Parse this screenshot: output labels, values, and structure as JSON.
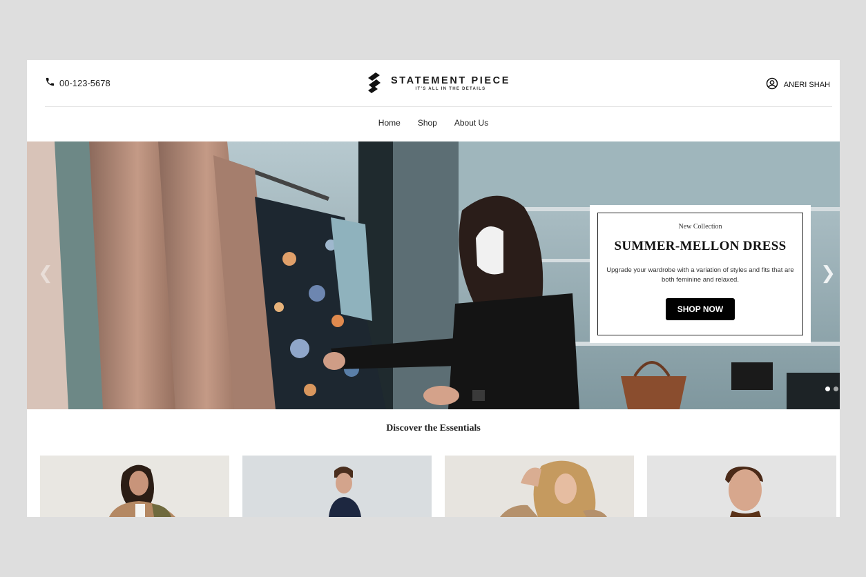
{
  "header": {
    "phone": "00-123-5678",
    "logo_name": "STATEMENT PIECE",
    "logo_tagline": "IT'S ALL IN THE DETAILS",
    "user_name": "ANERI SHAH"
  },
  "nav": {
    "items": [
      "Home",
      "Shop",
      "About Us"
    ]
  },
  "hero": {
    "eyebrow": "New Collection",
    "title": "SUMMER-MELLON DRESS",
    "description": "Upgrade your wardrobe with a variation of styles and fits that are both feminine and relaxed.",
    "cta": "SHOP NOW",
    "slides": 2,
    "active_slide": 1,
    "prev_icon": "chevron-left-icon",
    "next_icon": "chevron-right-icon"
  },
  "essentials": {
    "title": "Discover the Essentials",
    "cards": [
      "woman-camel-coat",
      "man-navy-coat",
      "woman-blonde-coat",
      "man-brown-sweater"
    ]
  },
  "colors": {
    "page_bg": "#dedede",
    "button_bg": "#000000",
    "accent": "#ffffff"
  }
}
